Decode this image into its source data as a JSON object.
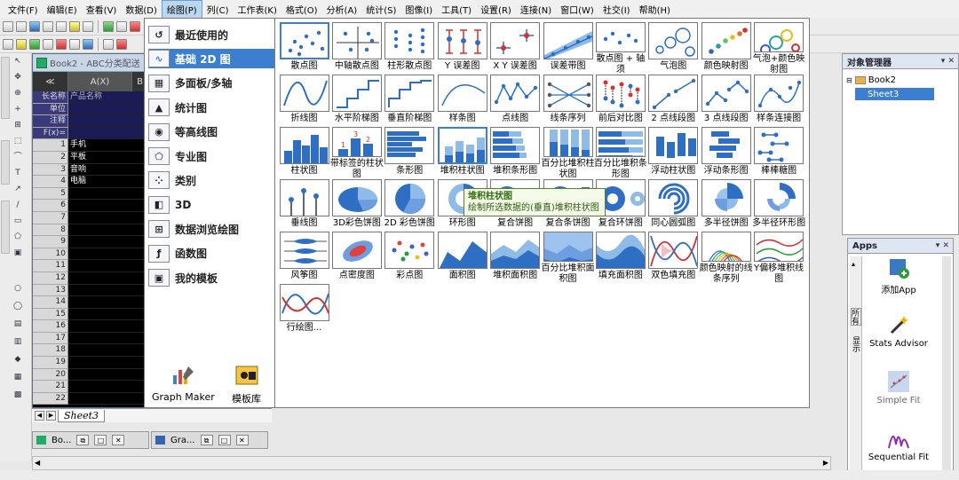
{
  "menu": [
    "文件(F)",
    "编辑(E)",
    "查看(V)",
    "数据(D)",
    "绘图(P)",
    "列(C)",
    "工作表(K)",
    "格式(O)",
    "分析(A)",
    "统计(S)",
    "图像(I)",
    "工具(T)",
    "设置(R)",
    "连接(N)",
    "窗口(W)",
    "社交(I)",
    "帮助(H)"
  ],
  "active_menu": "绘图(P)",
  "workbook": {
    "title": "Book2 - ABC分类配送",
    "col_a": "A(X)",
    "col_b": "B",
    "meta_rows": [
      {
        "h": "长名称",
        "v": "产品名称"
      },
      {
        "h": "单位",
        "v": ""
      },
      {
        "h": "注释",
        "v": ""
      },
      {
        "h": "F(x)=",
        "v": ""
      }
    ],
    "rows": [
      {
        "h": "1",
        "v": "手机"
      },
      {
        "h": "2",
        "v": "平板"
      },
      {
        "h": "3",
        "v": "音响"
      },
      {
        "h": "4",
        "v": "电脑"
      },
      {
        "h": "5",
        "v": ""
      },
      {
        "h": "6",
        "v": ""
      },
      {
        "h": "7",
        "v": ""
      },
      {
        "h": "8",
        "v": ""
      },
      {
        "h": "9",
        "v": ""
      },
      {
        "h": "10",
        "v": ""
      },
      {
        "h": "11",
        "v": ""
      },
      {
        "h": "12",
        "v": ""
      },
      {
        "h": "13",
        "v": ""
      },
      {
        "h": "14",
        "v": ""
      },
      {
        "h": "15",
        "v": ""
      },
      {
        "h": "16",
        "v": ""
      },
      {
        "h": "17",
        "v": ""
      },
      {
        "h": "18",
        "v": ""
      },
      {
        "h": "19",
        "v": ""
      },
      {
        "h": "20",
        "v": ""
      },
      {
        "h": "21",
        "v": ""
      },
      {
        "h": "22",
        "v": ""
      }
    ],
    "sheet_tab": "Sheet3"
  },
  "categories": [
    {
      "label": "最近使用的",
      "icon": "recent-icon"
    },
    {
      "label": "基础 2D 图",
      "icon": "basic-2d-icon"
    },
    {
      "label": "多面板/多轴",
      "icon": "multi-panel-icon"
    },
    {
      "label": "统计图",
      "icon": "statistics-icon"
    },
    {
      "label": "等高线图",
      "icon": "contour-icon"
    },
    {
      "label": "专业图",
      "icon": "specialized-icon"
    },
    {
      "label": "类别",
      "icon": "category-icon"
    },
    {
      "label": "3D",
      "icon": "3d-icon"
    },
    {
      "label": "数据浏览绘图",
      "icon": "data-explore-icon"
    },
    {
      "label": "函数图",
      "icon": "function-icon"
    },
    {
      "label": "我的模板",
      "icon": "my-template-icon"
    }
  ],
  "selected_category": "基础 2D 图",
  "bottom_buttons": {
    "graph_maker": "Graph Maker",
    "template_library": "模板库"
  },
  "charts": [
    "散点图",
    "中轴散点图",
    "柱形散点图",
    "Y 误差图",
    "X Y 误差图",
    "误差带图",
    "散点图 + 轴须",
    "气泡图",
    "颜色映射图",
    "气泡+颜色映射图",
    "折线图",
    "水平阶梯图",
    "垂直阶梯图",
    "样条图",
    "点线图",
    "线条序列",
    "前后对比图",
    "2 点线段图",
    "3 点线段图",
    "样条连接图",
    "柱状图",
    "带标签的柱状图",
    "条形图",
    "堆积柱状图",
    "堆积条形图",
    "百分比堆积柱状图",
    "百分比堆积条形图",
    "浮动柱状图",
    "浮动条形图",
    "棒棒糖图",
    "垂线图",
    "3D彩色饼图",
    "2D 彩色饼图",
    "环形图",
    "复合饼图",
    "复合条饼图",
    "复合环饼图",
    "同心圆弧图",
    "多半径饼图",
    "多半径环形图",
    "风筝图",
    "点密度图",
    "彩点图",
    "面积图",
    "堆积面积图",
    "百分比堆积面积图",
    "填充面积图",
    "双色填充图",
    "颜色映射的线条序列",
    "Y偏移堆积线图",
    "行绘图..."
  ],
  "tooltip": {
    "title": "堆积柱状图",
    "desc": "绘制所选数据的(垂直)堆积柱状图"
  },
  "object_manager": {
    "title": "对象管理器",
    "book": "Book2",
    "sheet": "Sheet3"
  },
  "apps": {
    "title": "Apps",
    "tab_all": "所有",
    "tab_installed": "显示",
    "items": [
      "添加App",
      "Stats Advisor",
      "Simple Fit",
      "Sequential Fit"
    ]
  },
  "minimized": [
    "Bo...",
    "Gra..."
  ],
  "colors": {
    "accent": "#3c7fd0",
    "blue_bar": "#2e6fc4",
    "light_blue": "#8fbbe8",
    "red": "#d63030"
  }
}
